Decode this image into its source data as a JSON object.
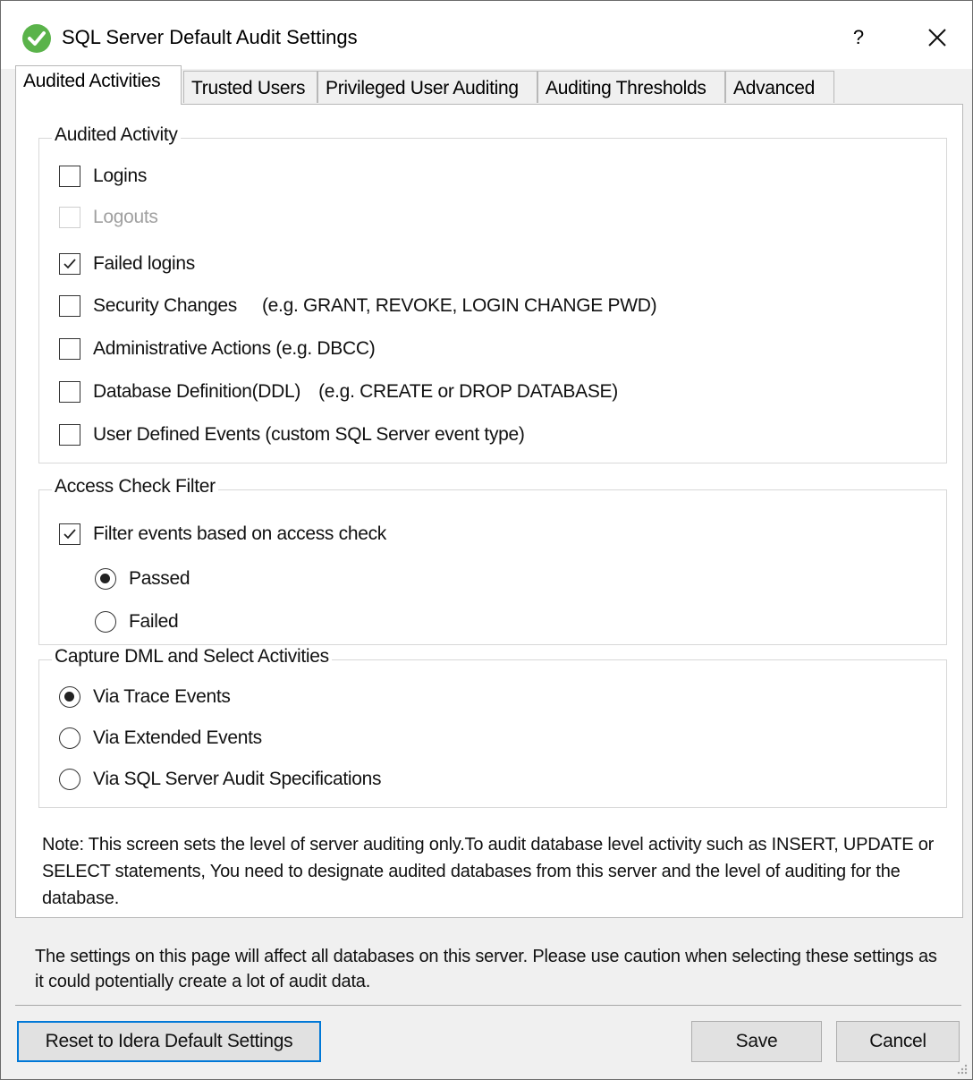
{
  "window": {
    "title": "SQL Server Default Audit Settings",
    "help_label": "?",
    "accent_color": "#0078d7",
    "icon_color": "#5ab34a"
  },
  "tabs": [
    {
      "label": "Audited Activities",
      "active": true
    },
    {
      "label": "Trusted Users",
      "active": false
    },
    {
      "label": "Privileged User Auditing",
      "active": false
    },
    {
      "label": "Auditing Thresholds",
      "active": false
    },
    {
      "label": "Advanced",
      "active": false
    }
  ],
  "audited_activity": {
    "title": "Audited Activity",
    "items": [
      {
        "label": "Logins",
        "checked": false,
        "enabled": true,
        "example": ""
      },
      {
        "label": "Logouts",
        "checked": false,
        "enabled": false,
        "example": ""
      },
      {
        "label": "Failed logins",
        "checked": true,
        "enabled": true,
        "example": ""
      },
      {
        "label": "Security Changes",
        "checked": false,
        "enabled": true,
        "example": "(e.g.  GRANT, REVOKE, LOGIN CHANGE PWD)"
      },
      {
        "label": "Administrative Actions (e.g. DBCC)",
        "checked": false,
        "enabled": true,
        "example": ""
      },
      {
        "label": "Database Definition(DDL)",
        "checked": false,
        "enabled": true,
        "example": "(e.g.  CREATE or DROP DATABASE)"
      },
      {
        "label": "User Defined Events (custom SQL Server event type)",
        "checked": false,
        "enabled": true,
        "example": ""
      }
    ]
  },
  "access_check": {
    "title": "Access Check Filter",
    "filter_label": "Filter events based on access check",
    "filter_checked": true,
    "options": [
      {
        "label": "Passed",
        "selected": true
      },
      {
        "label": "Failed",
        "selected": false
      }
    ]
  },
  "capture_dml": {
    "title": "Capture DML and Select Activities",
    "options": [
      {
        "label": "Via Trace Events",
        "selected": true
      },
      {
        "label": "Via Extended Events",
        "selected": false
      },
      {
        "label": "Via SQL Server Audit Specifications",
        "selected": false
      }
    ]
  },
  "note": "Note: This screen sets the level of server auditing only.To audit database level activity such as INSERT, UPDATE or SELECT statements, You need to designate audited databases from this server and the level of auditing for the database.",
  "warning": "The settings on this page will affect all databases on this server. Please use caution when selecting these settings as it could potentially create a lot of audit data.",
  "buttons": {
    "reset_label": "Reset to Idera Default Settings",
    "save_label": "Save",
    "cancel_label": "Cancel"
  }
}
